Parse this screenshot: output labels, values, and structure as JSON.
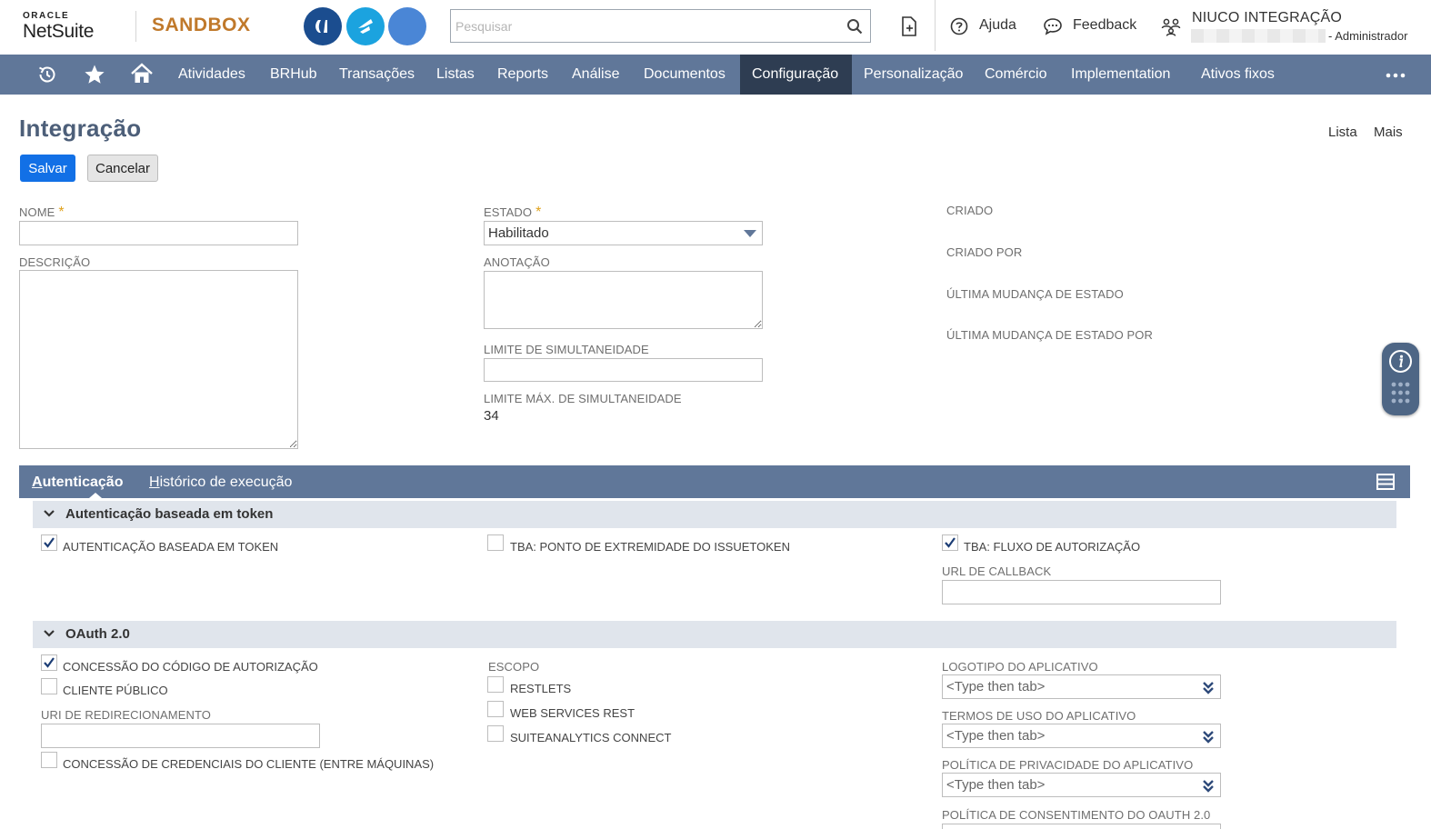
{
  "header": {
    "logo_top": "ORACLE",
    "logo_bottom": "NetSuite",
    "environment": "SANDBOX",
    "search_placeholder": "Pesquisar",
    "help_label": "Ajuda",
    "feedback_label": "Feedback",
    "account_name": "NIUCO INTEGRAÇÃO",
    "role": "- Administrador"
  },
  "nav": {
    "items": [
      {
        "label": "Atividades"
      },
      {
        "label": "BRHub"
      },
      {
        "label": "Transações"
      },
      {
        "label": "Listas"
      },
      {
        "label": "Reports"
      },
      {
        "label": "Análise"
      },
      {
        "label": "Documentos"
      },
      {
        "label": "Configuração",
        "active": true
      },
      {
        "label": "Personalização"
      },
      {
        "label": "Comércio"
      },
      {
        "label": "Implementation"
      },
      {
        "label": "Ativos fixos"
      }
    ]
  },
  "page": {
    "title": "Integração",
    "list_link": "Lista",
    "more_link": "Mais",
    "save_button": "Salvar",
    "cancel_button": "Cancelar"
  },
  "form": {
    "nome_label": "NOME",
    "nome_value": "",
    "descricao_label": "DESCRIÇÃO",
    "descricao_value": "",
    "estado_label": "ESTADO",
    "estado_value": "Habilitado",
    "anotacao_label": "ANOTAÇÃO",
    "anotacao_value": "",
    "limite_label": "LIMITE DE SIMULTANEIDADE",
    "limite_value": "",
    "limite_max_label": "LIMITE MÁX. DE SIMULTANEIDADE",
    "limite_max_value": "34",
    "required_mark": "*",
    "criado_label": "CRIADO",
    "criado_por_label": "CRIADO POR",
    "ultima_mudanca_label": "ÚLTIMA MUDANÇA DE ESTADO",
    "ultima_mudanca_por_label": "ÚLTIMA MUDANÇA DE ESTADO POR"
  },
  "tabs": {
    "auth_first": "A",
    "auth_rest": "utenticação",
    "hist_first": "H",
    "hist_rest": "istórico de execução"
  },
  "tba_section": {
    "title": "Autenticação baseada em token",
    "tba_label": "AUTENTICAÇÃO BASEADA EM TOKEN",
    "tba_checked": true,
    "issuetoken_label": "TBA: PONTO DE EXTREMIDADE DO ISSUETOKEN",
    "issuetoken_checked": false,
    "flow_label": "TBA: FLUXO DE AUTORIZAÇÃO",
    "flow_checked": true,
    "callback_label": "URL DE CALLBACK",
    "callback_value": ""
  },
  "oauth_section": {
    "title": "OAuth 2.0",
    "auth_code_label": "CONCESSÃO DO CÓDIGO DE AUTORIZAÇÃO",
    "auth_code_checked": true,
    "public_client_label": "CLIENTE PÚBLICO",
    "public_client_checked": false,
    "redirect_label": "URI DE REDIRECIONAMENTO",
    "redirect_value": "",
    "client_cred_label": "CONCESSÃO DE CREDENCIAIS DO CLIENTE (ENTRE MÁQUINAS)",
    "client_cred_checked": false,
    "scope_label": "ESCOPO",
    "restlets_label": "RESTLETS",
    "restlets_checked": false,
    "rest_ws_label": "WEB SERVICES REST",
    "rest_ws_checked": false,
    "suiteanalytics_label": "SUITEANALYTICS CONNECT",
    "suiteanalytics_checked": false,
    "logo_label": "LOGOTIPO DO APLICATIVO",
    "logo_value": "<Type then tab>",
    "terms_label": "TERMOS DE USO DO APLICATIVO",
    "terms_value": "<Type then tab>",
    "privacy_label": "POLÍTICA DE PRIVACIDADE DO APLICATIVO",
    "privacy_value": "<Type then tab>",
    "consent_label": "POLÍTICA DE CONSENTIMENTO DO OAUTH 2.0"
  },
  "colors": {
    "nav_bg": "#607799",
    "nav_active": "#2e3d52",
    "primary_button": "#1270e6",
    "sandbox_text": "#c0792b",
    "title_text": "#4d5f79"
  }
}
